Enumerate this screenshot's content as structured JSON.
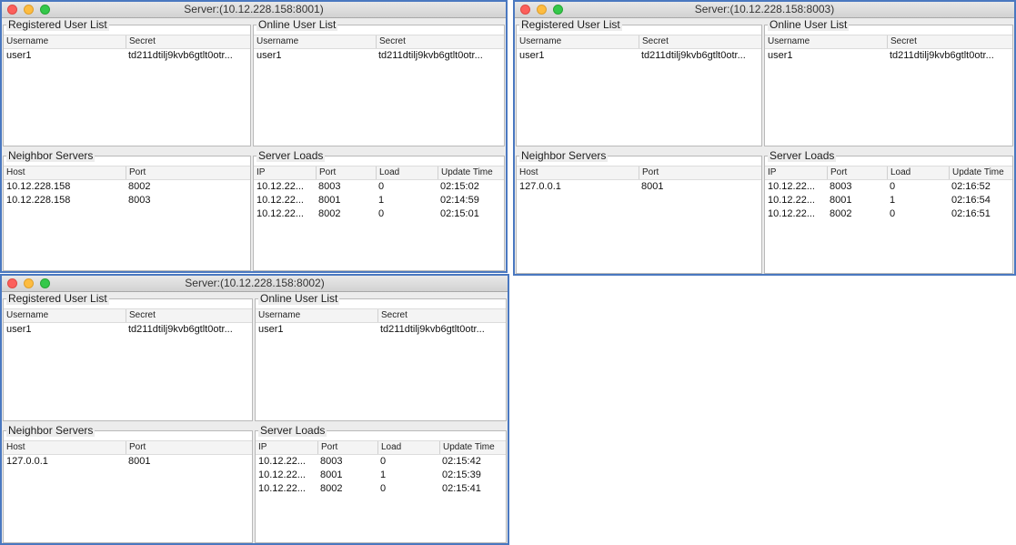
{
  "common": {
    "registered_title": "Registered User List",
    "online_title": "Online User List",
    "neighbor_title": "Neighbor  Servers",
    "loads_title": "Server Loads",
    "user_cols": [
      "Username",
      "Secret"
    ],
    "neighbor_cols": [
      "Host",
      "Port"
    ],
    "load_cols": [
      "IP",
      "Port",
      "Load",
      "Update Time"
    ]
  },
  "windows": [
    {
      "title": "Server:(10.12.228.158:8001)",
      "registered_users": [
        {
          "username": "user1",
          "secret": "td211dtilj9kvb6gtlt0otr..."
        }
      ],
      "online_users": [
        {
          "username": "user1",
          "secret": "td211dtilj9kvb6gtlt0otr..."
        }
      ],
      "neighbors": [
        {
          "host": "10.12.228.158",
          "port": "8002"
        },
        {
          "host": "10.12.228.158",
          "port": "8003"
        }
      ],
      "loads": [
        {
          "ip": "10.12.22...",
          "port": "8003",
          "load": "0",
          "time": "02:15:02"
        },
        {
          "ip": "10.12.22...",
          "port": "8001",
          "load": "1",
          "time": "02:14:59"
        },
        {
          "ip": "10.12.22...",
          "port": "8002",
          "load": "0",
          "time": "02:15:01"
        }
      ]
    },
    {
      "title": "Server:(10.12.228.158:8003)",
      "registered_users": [
        {
          "username": "user1",
          "secret": "td211dtilj9kvb6gtlt0otr..."
        }
      ],
      "online_users": [
        {
          "username": "user1",
          "secret": "td211dtilj9kvb6gtlt0otr..."
        }
      ],
      "neighbors": [
        {
          "host": "127.0.0.1",
          "port": "8001"
        }
      ],
      "loads": [
        {
          "ip": "10.12.22...",
          "port": "8003",
          "load": "0",
          "time": "02:16:52"
        },
        {
          "ip": "10.12.22...",
          "port": "8001",
          "load": "1",
          "time": "02:16:54"
        },
        {
          "ip": "10.12.22...",
          "port": "8002",
          "load": "0",
          "time": "02:16:51"
        }
      ]
    },
    {
      "title": "Server:(10.12.228.158:8002)",
      "registered_users": [
        {
          "username": "user1",
          "secret": "td211dtilj9kvb6gtlt0otr..."
        }
      ],
      "online_users": [
        {
          "username": "user1",
          "secret": "td211dtilj9kvb6gtlt0otr..."
        }
      ],
      "neighbors": [
        {
          "host": "127.0.0.1",
          "port": "8001"
        }
      ],
      "loads": [
        {
          "ip": "10.12.22...",
          "port": "8003",
          "load": "0",
          "time": "02:15:42"
        },
        {
          "ip": "10.12.22...",
          "port": "8001",
          "load": "1",
          "time": "02:15:39"
        },
        {
          "ip": "10.12.22...",
          "port": "8002",
          "load": "0",
          "time": "02:15:41"
        }
      ]
    }
  ]
}
